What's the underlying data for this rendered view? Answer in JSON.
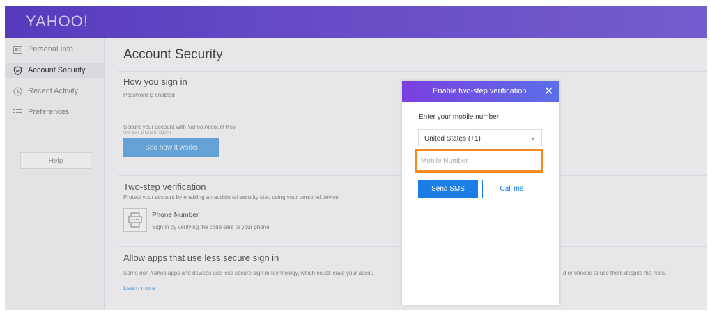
{
  "header": {
    "logo": "YAHOO!"
  },
  "sidebar": {
    "items": [
      {
        "label": "Personal Info",
        "icon": "id-card-icon"
      },
      {
        "label": "Account Security",
        "icon": "shield-icon"
      },
      {
        "label": "Recent Activity",
        "icon": "clock-icon"
      },
      {
        "label": "Preferences",
        "icon": "list-icon"
      }
    ],
    "help_label": "Help"
  },
  "main": {
    "title": "Account Security",
    "sign_in": {
      "heading": "How you sign in",
      "password_status": "Password is enabled",
      "account_key_text": "Secure your account with Yahoo Account Key.",
      "account_key_sub": "Use your phone to sign in",
      "see_how_button": "See how it works"
    },
    "two_step": {
      "heading": "Two-step verification",
      "description": "Protect your account by enabling an additional security step using your personal device.",
      "phone_title": "Phone Number",
      "phone_desc": "Sign in by verifying the code sent to your phone."
    },
    "less_secure": {
      "heading": "Allow apps that use less secure sign in",
      "description_left": "Some non-Yahoo apps and devices use less secure sign-in technology, which could leave your accou",
      "description_right": "d or choose to use them despite the risks.",
      "learn_more": "Learn more"
    }
  },
  "modal": {
    "title": "Enable two-step verification",
    "close_symbol": "✕",
    "label": "Enter your mobile number",
    "country_value": "United States (+1)",
    "mobile_placeholder": "Mobile Number",
    "send_sms": "Send SMS",
    "call_me": "Call me"
  },
  "colors": {
    "header_bg": "#6c4fd1",
    "primary_blue": "#1a7ee6",
    "highlight": "#f58a1f"
  }
}
